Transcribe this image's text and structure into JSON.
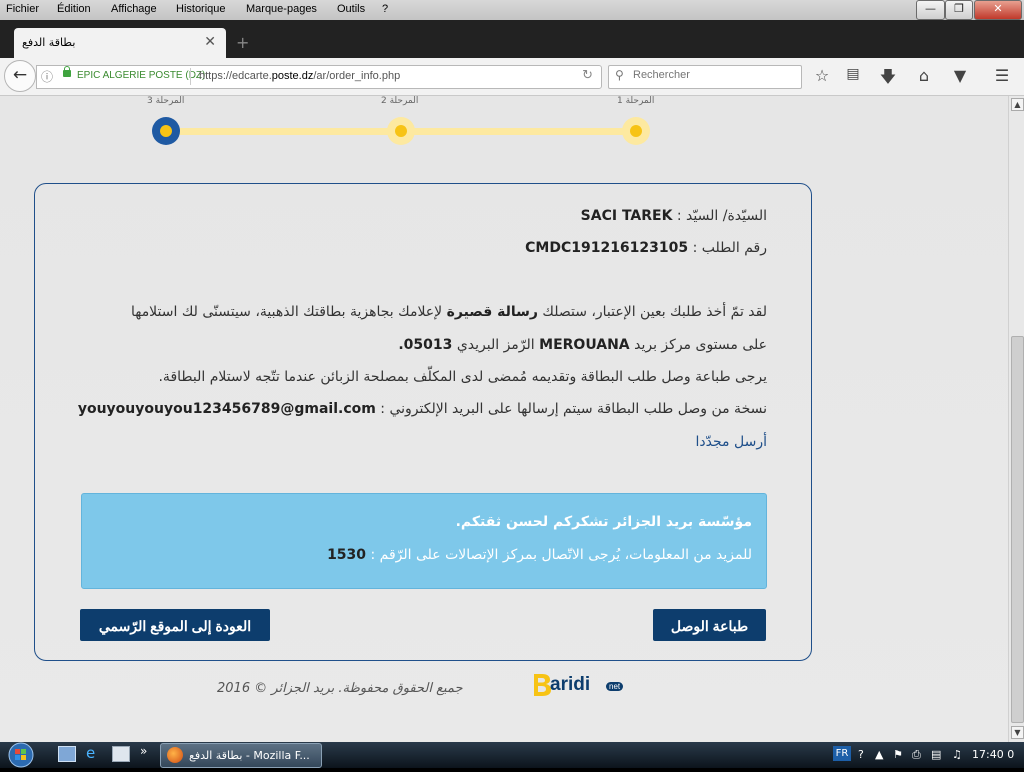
{
  "menu": {
    "items": [
      "Fichier",
      "Édition",
      "Affichage",
      "Historique",
      "Marque-pages",
      "Outils",
      "?"
    ]
  },
  "window": {
    "minimize": "—",
    "maximize": "❐",
    "close": "✕"
  },
  "tab": {
    "title": "بطاقة الدفع",
    "close": "✕",
    "new_tab": "+"
  },
  "nav": {
    "site_identity": "EPIC ALGERIE POSTE (DZ)",
    "url_prefix": "https://edcarte.",
    "url_domain": "poste.dz",
    "url_path": "/ar/order_info.php",
    "search_placeholder": "Rechercher"
  },
  "steps": [
    "المرحلة 3",
    "المرحلة 2",
    "المرحلة 1"
  ],
  "order": {
    "name_label": "السيّدة/ السيّد :",
    "name_value": "SACI TAREK",
    "number_label": "رقم الطلب :",
    "number_value": "CMDC191216123105",
    "msg_line1_a": "لقد تمّ أخذ طلبك بعين الإعتبار، ستصلك",
    "msg_line1_b": "رسالة قصيرة",
    "msg_line1_c": "لإعلامك بجاهزية بطاقتك الذهبية، سيتسنّى لك استلامها",
    "msg_line2_a": "على مستوى مركز بريد",
    "msg_line2_office": "MEROUANA",
    "msg_line2_b": "الرّمز البريدي",
    "msg_line2_code": "05013.",
    "msg_line3": "يرجى طباعة وصل طلب البطاقة وتقديمه مُمضى لدى المكلّف بمصلحة الزبائن عندما تتّجه لاستلام البطاقة.",
    "msg_line4_a": "نسخة من وصل طلب البطاقة سيتم إرسالها على البريد الإلكتروني :",
    "msg_line4_email": "youyouyouyou123456789@gmail.com",
    "resend": "أرسل مجدّدا"
  },
  "info": {
    "line1": "مؤسّسة بريد الجزائر تشكركم لحسن ثقتكم.",
    "line2_a": "للمزيد من المعلومات، يُرجى الاتّصال بمركز الإتصالات على الرّقم :",
    "line2_num": "1530"
  },
  "buttons": {
    "print": "طباعة الوصل",
    "back_home": "العودة إلى الموقع الرّسمي"
  },
  "footer": {
    "text": "جميع الحقوق محفوظة. بريد الجزائر © 2016",
    "logo_text": "aridi",
    "logo_net": "net"
  },
  "taskbar": {
    "window_title": "بطاقة الدفع - Mozilla F...",
    "lang": "FR",
    "clock": "17:40 0",
    "more": "»"
  },
  "colors": {
    "accent": "#0d3d6d",
    "step_done": "#f7c315",
    "step_track": "#fde9a0",
    "info_bg": "#7ec8ea"
  }
}
